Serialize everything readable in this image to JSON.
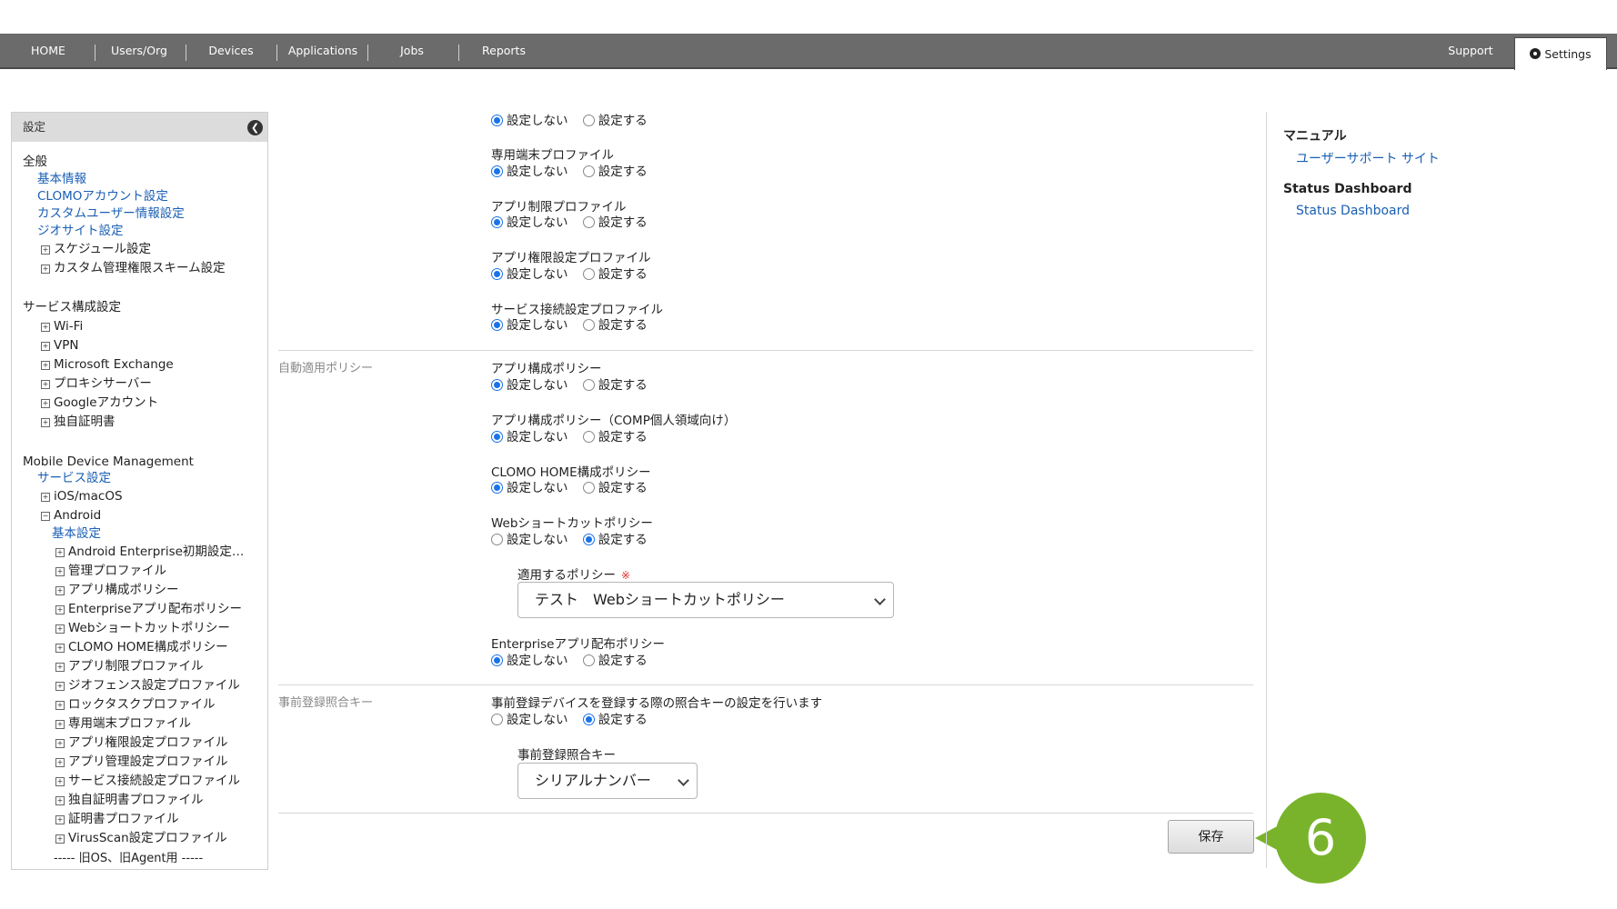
{
  "nav": {
    "items": [
      "HOME",
      "Users/Org",
      "Devices",
      "Applications",
      "Jobs",
      "Reports"
    ],
    "support": "Support",
    "settings": "Settings"
  },
  "sidebar": {
    "header": "設定",
    "general": {
      "title": "全般",
      "links": [
        "基本情報",
        "CLOMOアカウント設定",
        "カスタムユーザー情報設定",
        "ジオサイト設定"
      ],
      "expandables": [
        "スケジュール設定",
        "カスタム管理権限スキーム設定"
      ]
    },
    "service": {
      "title": "サービス構成設定",
      "items": [
        "Wi-Fi",
        "VPN",
        "Microsoft Exchange",
        "プロキシサーバー",
        "Googleアカウント",
        "独自証明書"
      ]
    },
    "mdm": {
      "title": "Mobile Device Management",
      "service_link": "サービス設定",
      "ios": "iOS/macOS",
      "android": "Android",
      "android_basic": "基本設定",
      "android_items": [
        "Android Enterprise初期設定…",
        "管理プロファイル",
        "アプリ構成ポリシー",
        "Enterpriseアプリ配布ポリシー",
        "Webショートカットポリシー",
        "CLOMO HOME構成ポリシー",
        "アプリ制限プロファイル",
        "ジオフェンス設定プロファイル",
        "ロックタスクプロファイル",
        "専用端末プロファイル",
        "アプリ権限設定プロファイル",
        "アプリ管理設定プロファイル",
        "サービス接続設定プロファイル",
        "独自証明書プロファイル",
        "証明書プロファイル",
        "VirusScan設定プロファイル"
      ],
      "legacy": "----- 旧OS、旧Agent用 -----"
    }
  },
  "options": {
    "off": "設定しない",
    "on": "設定する"
  },
  "form": {
    "top_fields": [
      "専用端末プロファイル",
      "アプリ制限プロファイル",
      "アプリ権限設定プロファイル",
      "サービス接続設定プロファイル"
    ],
    "auto_policy": {
      "label": "自動適用ポリシー",
      "fields": [
        "アプリ構成ポリシー",
        "アプリ構成ポリシー（COMP個人領域向け）",
        "CLOMO HOME構成ポリシー",
        "Webショートカットポリシー"
      ],
      "apply_label": "適用するポリシー",
      "required_mark": "※",
      "apply_value": "テスト　Webショートカットポリシー",
      "enterprise_field": "Enterpriseアプリ配布ポリシー"
    },
    "prereg": {
      "label": "事前登録照合キー",
      "description": "事前登録デバイスを登録する際の照合キーの設定を行います",
      "key_label": "事前登録照合キー",
      "key_value": "シリアルナンバー"
    },
    "save": "保存",
    "step": "6"
  },
  "right": {
    "manual_title": "マニュアル",
    "manual_link": "ユーザーサポート サイト",
    "status_title": "Status Dashboard",
    "status_link": "Status Dashboard"
  }
}
